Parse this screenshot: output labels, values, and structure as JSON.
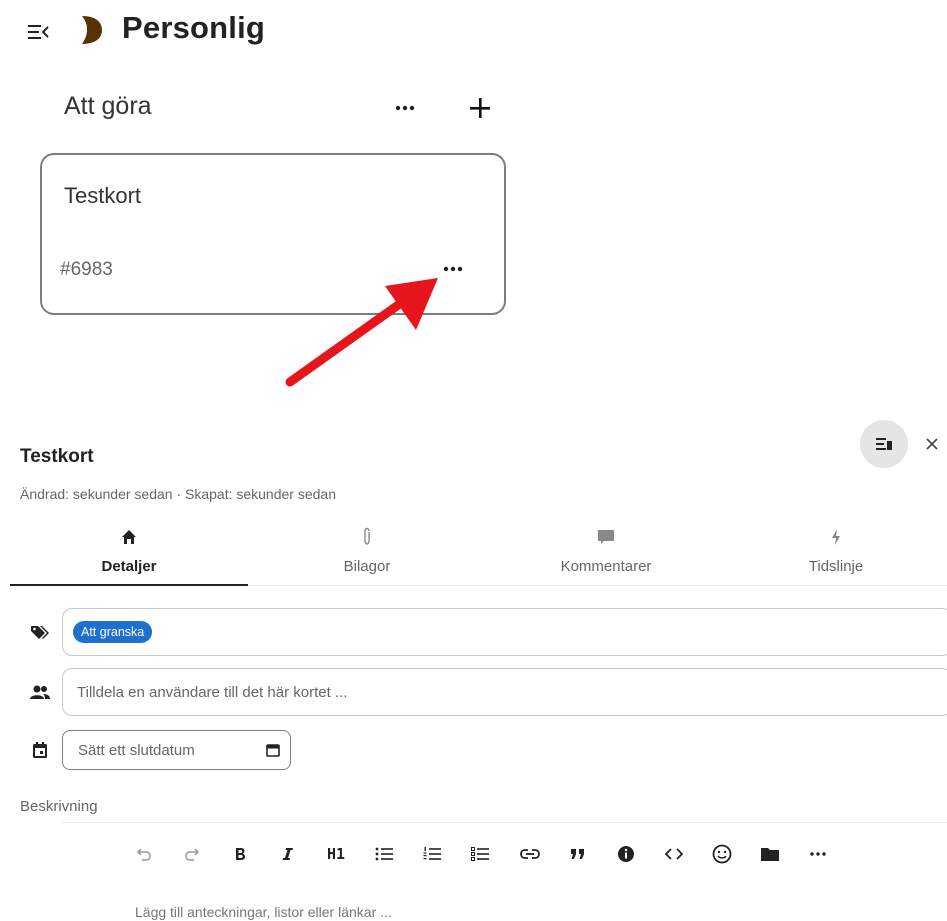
{
  "header": {
    "board_title": "Personlig",
    "menu_icon": "menu-collapse-icon",
    "board_icon": "board-color-icon"
  },
  "stack": {
    "title": "Att göra",
    "menu_icon": "more-horizontal-icon",
    "add_icon": "plus-icon"
  },
  "card": {
    "title": "Testkort",
    "id": "#6983",
    "menu_icon": "more-horizontal-icon"
  },
  "annotation": {
    "arrow_color": "#e8141b"
  },
  "detail": {
    "title": "Testkort",
    "subtitle": "Ändrad: sekunder sedan · Skapat: sekunder sedan",
    "tabs": [
      {
        "label": "Detaljer",
        "icon": "home-icon"
      },
      {
        "label": "Bilagor",
        "icon": "paperclip-icon"
      },
      {
        "label": "Kommentarer",
        "icon": "comment-icon"
      },
      {
        "label": "Tidslinje",
        "icon": "lightning-icon"
      }
    ],
    "tags": [
      {
        "label": "Att granska",
        "color": "#1f6fcf"
      }
    ],
    "assign_placeholder": "Tilldela en användare till det här kortet ...",
    "due_placeholder": "Sätt ett slutdatum",
    "description_label": "Beskrivning",
    "editor_placeholder": "Lägg till anteckningar, listor eller länkar ...",
    "toolbar": {
      "h1_label": "H1"
    }
  },
  "colors": {
    "tag_blue": "#1f6fcf",
    "toggle_bg": "#e5e5e5",
    "text_dark": "#222222"
  }
}
